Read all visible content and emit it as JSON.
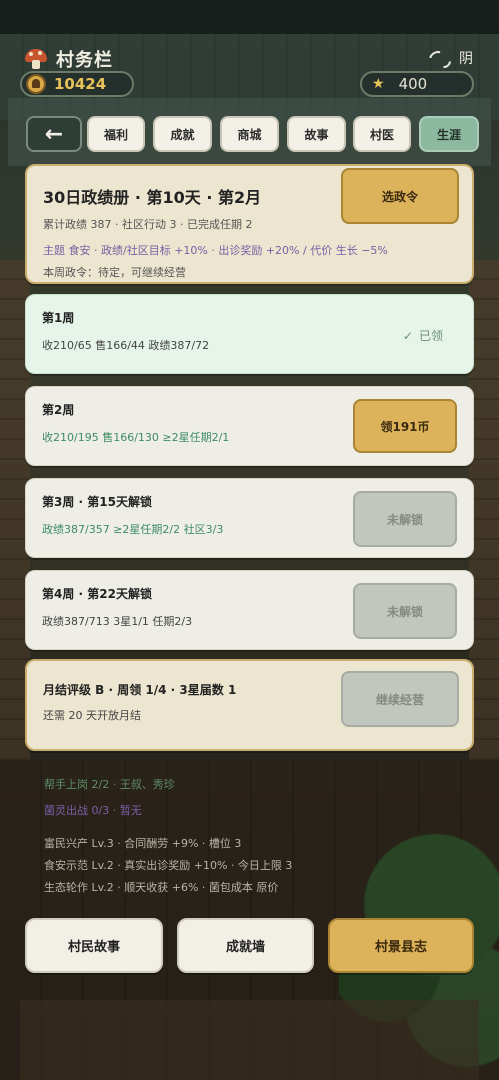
{
  "header": {
    "title": "村务栏",
    "weather": "阴",
    "coins": "10424",
    "stars": "400"
  },
  "tabs": [
    {
      "label": "←"
    },
    {
      "label": "福利"
    },
    {
      "label": "成就"
    },
    {
      "label": "商城"
    },
    {
      "label": "故事"
    },
    {
      "label": "村医"
    },
    {
      "label": "生涯"
    }
  ],
  "summary": {
    "title": "30日政绩册 · 第10天 · 第2月",
    "line1": "累计政绩 387 · 社区行动 3 · 已完成任期 2",
    "line2": "主题 食安 · 政绩/社区目标 +10% · 出诊奖励 +20% / 代价 生长 −5%",
    "line3": "本周政令：待定，可继续经营",
    "button": "选政令"
  },
  "weeks": [
    {
      "title": "第1周",
      "detail": "收210/65 售166/44 政绩387/72",
      "status": "已领"
    },
    {
      "title": "第2周",
      "detail": "收210/195 售166/130 ≥2星任期2/1",
      "button": "领191币"
    },
    {
      "title": "第3周 · 第15天解锁",
      "detail": "政绩387/357 ≥2星任期2/2 社区3/3",
      "button": "未解锁"
    },
    {
      "title": "第4周 · 第22天解锁",
      "detail": "政绩387/713 3星1/1 任期2/3",
      "button": "未解锁"
    }
  ],
  "month": {
    "title": "月结评级 B · 周领 1/4 · 3星届数 1",
    "detail": "还需 20 天开放月结",
    "button": "继续经营"
  },
  "info": {
    "helpers": "帮手上岗 2/2 · 王叔、秀珍",
    "fungi": "菌灵出战 0/3 · 暂无",
    "policy1": "富民兴产 Lv.3 · 合同酬劳 +9% · 槽位 3",
    "policy2": "食安示范 Lv.2 · 真实出诊奖励 +10% · 今日上限 3",
    "policy3": "生态轮作 Lv.2 · 顺天收获 +6% · 菌包成本 原价"
  },
  "bottom": {
    "stories": "村民故事",
    "achievements": "成就墙",
    "chronicle": "村景县志"
  },
  "colors": {
    "gold": "#dcb25a",
    "active_tab": "#8eb9a1",
    "claimed_card": "#e6f4ea"
  }
}
